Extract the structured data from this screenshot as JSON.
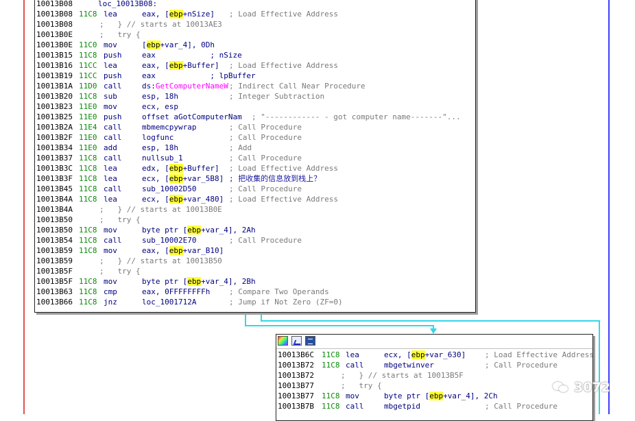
{
  "node_main": {
    "lines": [
      {
        "addr": "10013B08",
        "sp": "",
        "mn": "",
        "ops": [
          {
            "t": "loc_10013B08:",
            "c": "lbl"
          }
        ],
        "cm": []
      },
      {
        "addr": "10013B08",
        "sp": "11C8",
        "mn": "lea",
        "ops": [
          {
            "t": "eax, ["
          },
          {
            "t": "ebp",
            "c": "hl"
          },
          {
            "t": "+nSize]"
          }
        ],
        "cm": [
          {
            "t": "; Load Effective Address"
          }
        ]
      },
      {
        "addr": "10013B08",
        "sp": "",
        "mn": ";   } // starts at 10013AE3",
        "ops": [],
        "cm": []
      },
      {
        "addr": "10013B0E",
        "sp": "",
        "mn": ";   try {",
        "ops": [],
        "cm": []
      },
      {
        "addr": "10013B0E",
        "sp": "11C0",
        "mn": "mov",
        "ops": [
          {
            "t": "["
          },
          {
            "t": "ebp",
            "c": "hl"
          },
          {
            "t": "+var_4], 0Dh"
          }
        ],
        "cm": []
      },
      {
        "addr": "10013B15",
        "sp": "11C8",
        "mn": "push",
        "ops": [
          {
            "t": "eax            ; nSize"
          }
        ],
        "cm": []
      },
      {
        "addr": "10013B16",
        "sp": "11CC",
        "mn": "lea",
        "ops": [
          {
            "t": "eax, ["
          },
          {
            "t": "ebp",
            "c": "hl"
          },
          {
            "t": "+Buffer]"
          }
        ],
        "cm": [
          {
            "t": "; Load Effective Address"
          }
        ]
      },
      {
        "addr": "10013B19",
        "sp": "11CC",
        "mn": "push",
        "ops": [
          {
            "t": "eax            ; lpBuffer"
          }
        ],
        "cm": []
      },
      {
        "addr": "10013B1A",
        "sp": "11D0",
        "mn": "call",
        "ops": [
          {
            "t": "ds:"
          },
          {
            "t": "GetComputerNameW",
            "c": "api"
          }
        ],
        "cm": [
          {
            "t": "; Indirect Call Near Procedure"
          }
        ]
      },
      {
        "addr": "10013B20",
        "sp": "11C8",
        "mn": "sub",
        "ops": [
          {
            "t": "esp, 18h"
          }
        ],
        "cm": [
          {
            "t": "; Integer Subtraction"
          }
        ]
      },
      {
        "addr": "10013B23",
        "sp": "11E0",
        "mn": "mov",
        "ops": [
          {
            "t": "ecx, esp"
          }
        ],
        "cm": []
      },
      {
        "addr": "10013B25",
        "sp": "11E0",
        "mn": "push",
        "ops": [
          {
            "t": "offset aGotComputerNam"
          }
        ],
        "cm": [
          {
            "t": "; \"------------ - got computer name-------\"..."
          }
        ]
      },
      {
        "addr": "10013B2A",
        "sp": "11E4",
        "mn": "call",
        "ops": [
          {
            "t": "mbmemcpywrap"
          }
        ],
        "cm": [
          {
            "t": "; Call Procedure"
          }
        ]
      },
      {
        "addr": "10013B2F",
        "sp": "11E0",
        "mn": "call",
        "ops": [
          {
            "t": "logfunc"
          }
        ],
        "cm": [
          {
            "t": "; Call Procedure"
          }
        ]
      },
      {
        "addr": "10013B34",
        "sp": "11E0",
        "mn": "add",
        "ops": [
          {
            "t": "esp, 18h"
          }
        ],
        "cm": [
          {
            "t": "; Add"
          }
        ]
      },
      {
        "addr": "10013B37",
        "sp": "11C8",
        "mn": "call",
        "ops": [
          {
            "t": "nullsub_1"
          }
        ],
        "cm": [
          {
            "t": "; Call Procedure"
          }
        ]
      },
      {
        "addr": "10013B3C",
        "sp": "11C8",
        "mn": "lea",
        "ops": [
          {
            "t": "edx, ["
          },
          {
            "t": "ebp",
            "c": "hl"
          },
          {
            "t": "+Buffer]"
          }
        ],
        "cm": [
          {
            "t": "; Load Effective Address"
          }
        ]
      },
      {
        "addr": "10013B3F",
        "sp": "11C8",
        "mn": "lea",
        "ops": [
          {
            "t": "ecx, ["
          },
          {
            "t": "ebp",
            "c": "hl"
          },
          {
            "t": "+var_5B8]"
          }
        ],
        "cm": [
          {
            "t": "; 把收集的信息放到栈上？",
            "c": "cn"
          }
        ]
      },
      {
        "addr": "10013B45",
        "sp": "11C8",
        "mn": "call",
        "ops": [
          {
            "t": "sub_10002D50"
          }
        ],
        "cm": [
          {
            "t": "; Call Procedure"
          }
        ]
      },
      {
        "addr": "10013B4A",
        "sp": "11C8",
        "mn": "lea",
        "ops": [
          {
            "t": "ecx, ["
          },
          {
            "t": "ebp",
            "c": "hl"
          },
          {
            "t": "+var_480]"
          }
        ],
        "cm": [
          {
            "t": "; Load Effective Address"
          }
        ]
      },
      {
        "addr": "10013B4A",
        "sp": "",
        "mn": ";   } // starts at 10013B0E",
        "ops": [],
        "cm": []
      },
      {
        "addr": "10013B50",
        "sp": "",
        "mn": ";   try {",
        "ops": [],
        "cm": []
      },
      {
        "addr": "10013B50",
        "sp": "11C8",
        "mn": "mov",
        "ops": [
          {
            "t": "byte ptr ["
          },
          {
            "t": "ebp",
            "c": "hl"
          },
          {
            "t": "+var_4], 2Ah"
          }
        ],
        "cm": []
      },
      {
        "addr": "10013B54",
        "sp": "11C8",
        "mn": "call",
        "ops": [
          {
            "t": "sub_10002E70"
          }
        ],
        "cm": [
          {
            "t": "; Call Procedure"
          }
        ]
      },
      {
        "addr": "10013B59",
        "sp": "11C8",
        "mn": "mov",
        "ops": [
          {
            "t": "eax, ["
          },
          {
            "t": "ebp",
            "c": "hl"
          },
          {
            "t": "+var_B10]"
          }
        ],
        "cm": []
      },
      {
        "addr": "10013B59",
        "sp": "",
        "mn": ";   } // starts at 10013B50",
        "ops": [],
        "cm": []
      },
      {
        "addr": "10013B5F",
        "sp": "",
        "mn": ";   try {",
        "ops": [],
        "cm": []
      },
      {
        "addr": "10013B5F",
        "sp": "11C8",
        "mn": "mov",
        "ops": [
          {
            "t": "byte ptr ["
          },
          {
            "t": "ebp",
            "c": "hl"
          },
          {
            "t": "+var_4], 2Bh"
          }
        ],
        "cm": []
      },
      {
        "addr": "10013B63",
        "sp": "11C8",
        "mn": "cmp",
        "ops": [
          {
            "t": "eax, 0FFFFFFFFh"
          }
        ],
        "cm": [
          {
            "t": "; Compare Two Operands"
          }
        ]
      },
      {
        "addr": "10013B66",
        "sp": "11C8",
        "mn": "jnz",
        "ops": [
          {
            "t": "loc_1001712A"
          }
        ],
        "cm": [
          {
            "t": "; Jump if Not Zero (ZF=0)"
          }
        ]
      }
    ]
  },
  "node_sub": {
    "toolbar": {
      "icons": [
        "palette-icon",
        "graph-icon",
        "code-icon"
      ]
    },
    "lines": [
      {
        "addr": "10013B6C",
        "sp": "11C8",
        "mn": "lea",
        "ops": [
          {
            "t": "ecx, ["
          },
          {
            "t": "ebp",
            "c": "hl"
          },
          {
            "t": "+var_630]"
          }
        ],
        "cm": [
          {
            "t": "; Load Effective Address"
          }
        ]
      },
      {
        "addr": "10013B72",
        "sp": "11C8",
        "mn": "call",
        "ops": [
          {
            "t": "mbgetwinver"
          }
        ],
        "cm": [
          {
            "t": "; Call Procedure"
          }
        ]
      },
      {
        "addr": "10013B72",
        "sp": "",
        "mn": ";   } // starts at 10013B5F",
        "ops": [],
        "cm": []
      },
      {
        "addr": "10013B77",
        "sp": "",
        "mn": ";   try {",
        "ops": [],
        "cm": []
      },
      {
        "addr": "10013B77",
        "sp": "11C8",
        "mn": "mov",
        "ops": [
          {
            "t": "byte ptr ["
          },
          {
            "t": "ebp",
            "c": "hl"
          },
          {
            "t": "+var_4], 2Ch"
          }
        ],
        "cm": []
      },
      {
        "addr": "10013B7B",
        "sp": "11C8",
        "mn": "call",
        "ops": [
          {
            "t": "mbgetpid"
          }
        ],
        "cm": [
          {
            "t": "; Call Procedure"
          }
        ]
      }
    ]
  },
  "watermark": {
    "text": "3072"
  },
  "colors": {
    "edge_red": "#e05252",
    "edge_blue": "#3b3bff",
    "edge_cyan": "#33d6e8",
    "highlight": "#ffff33",
    "api": "#ff00ff"
  }
}
